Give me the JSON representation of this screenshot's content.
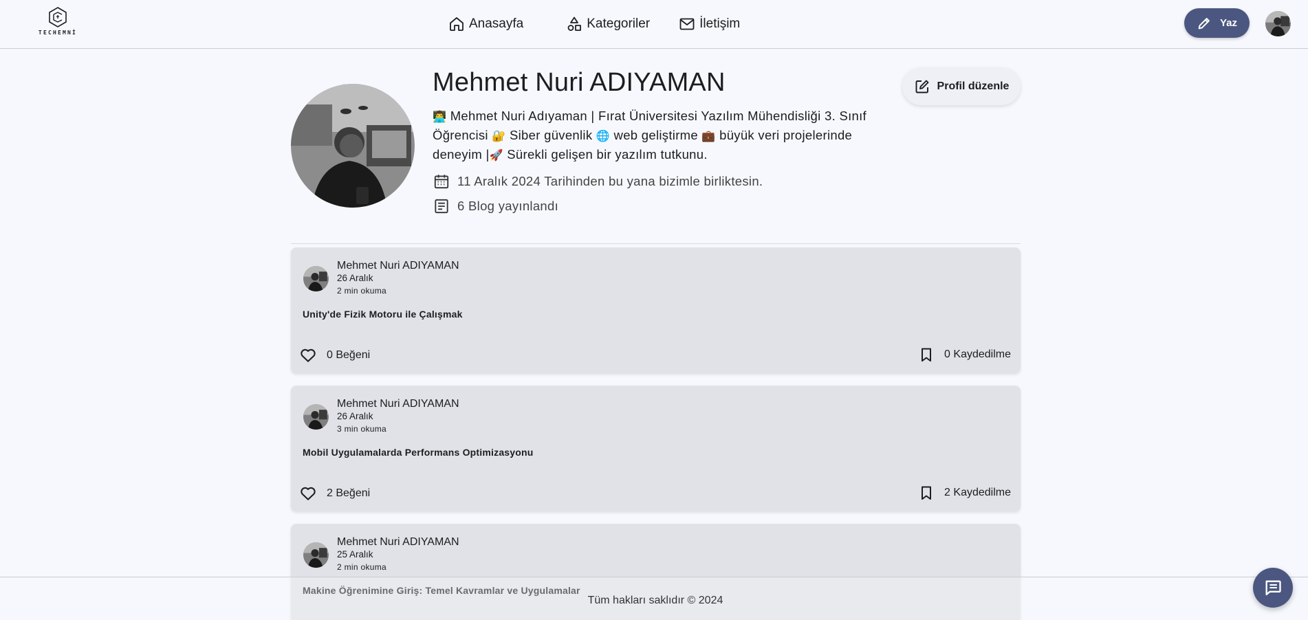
{
  "brand": {
    "logo_text": "TECHEMNİ"
  },
  "nav": {
    "items": [
      {
        "label": "Anasayfa",
        "icon": "home-icon"
      },
      {
        "label": "Kategoriler",
        "icon": "shapes-icon"
      },
      {
        "label": "İletişim",
        "icon": "mail-icon"
      }
    ],
    "write_label": "Yaz"
  },
  "profile": {
    "name": "Mehmet Nuri ADIYAMAN",
    "bio": {
      "e1": "👨‍💻",
      "t1": "Mehmet Nuri Adıyaman | Fırat Üniversitesi Yazılım Mühendisliği 3. Sınıf Öğrencisi",
      "e2": "🔐",
      "t2": "Siber güvenlik",
      "e3": "🌐",
      "t3": "web geliştirme",
      "e4": "💼",
      "t4": "büyük veri projelerinde deneyim |",
      "e5": "🚀",
      "t5": "Sürekli gelişen bir yazılım tutkunu."
    },
    "joined": "11 Aralık 2024 Tarihinden bu yana bizimle birliktesin.",
    "blog_count": "6 Blog yayınlandı",
    "edit_label": "Profil düzenle"
  },
  "posts": [
    {
      "author": "Mehmet Nuri ADIYAMAN",
      "date": "26 Aralık",
      "read_time": "2 min okuma",
      "title": "Unity'de Fizik Motoru ile Çalışmak",
      "likes": "0 Beğeni",
      "saves": "0 Kaydedilme"
    },
    {
      "author": "Mehmet Nuri ADIYAMAN",
      "date": "26 Aralık",
      "read_time": "3 min okuma",
      "title": "Mobil Uygulamalarda Performans Optimizasyonu",
      "likes": "2 Beğeni",
      "saves": "2 Kaydedilme"
    },
    {
      "author": "Mehmet Nuri ADIYAMAN",
      "date": "25 Aralık",
      "read_time": "2 min okuma",
      "title": "Makine Öğrenimine Giriş: Temel Kavramlar ve Uygulamalar",
      "likes": "",
      "saves": ""
    }
  ],
  "footer": {
    "text": "Tüm hakları saklıdır © 2024"
  },
  "colors": {
    "accent": "#4b5780",
    "background": "#f6f8fd",
    "card": "#e1e2e7"
  }
}
